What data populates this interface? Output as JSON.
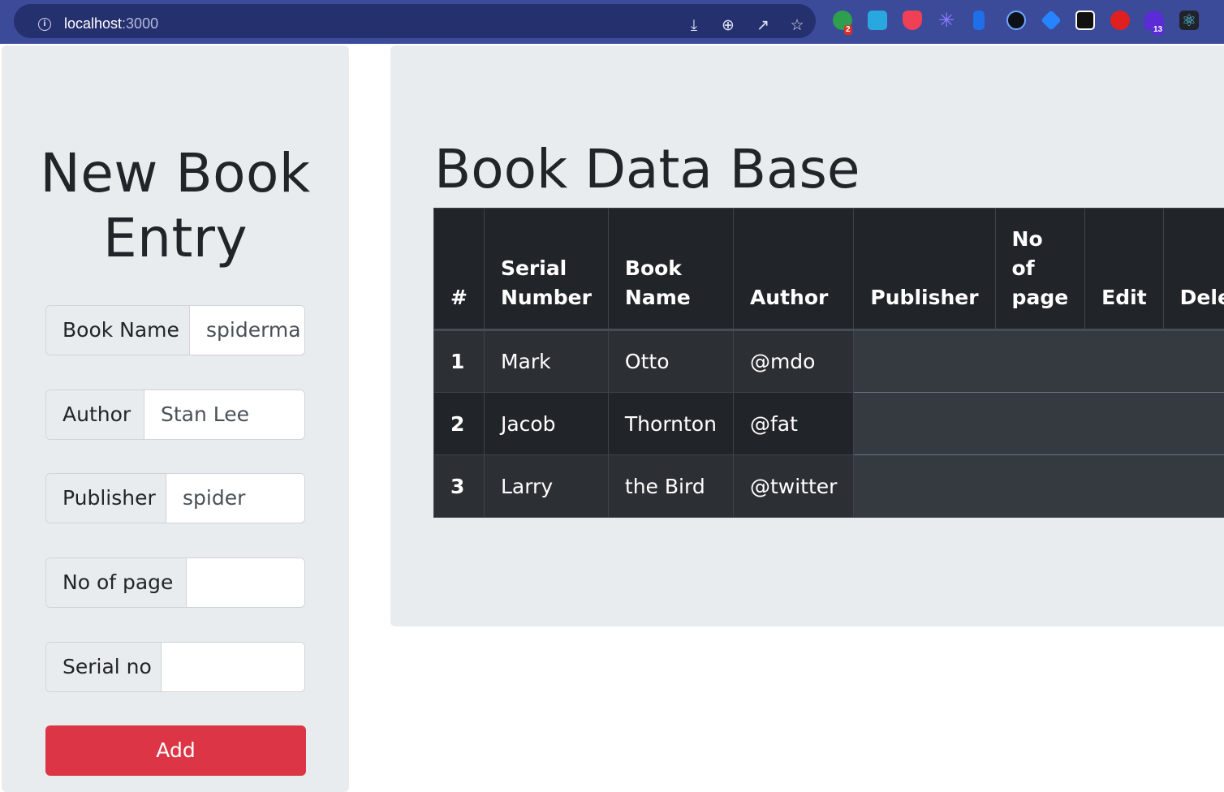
{
  "browser": {
    "url_host": "localhost",
    "url_port": ":3000",
    "extension_badges": [
      "2",
      "13"
    ]
  },
  "entry_form": {
    "title_line1": "New Book",
    "title_line2": "Entry",
    "fields": [
      {
        "label": "Book Name",
        "value": "spiderma"
      },
      {
        "label": "Author",
        "value": "Stan Lee"
      },
      {
        "label": "Publisher",
        "value": "spider"
      },
      {
        "label": "No of page",
        "value": ""
      },
      {
        "label": "Serial no",
        "value": ""
      }
    ],
    "add_label": "Add"
  },
  "database": {
    "title": "Book Data Base",
    "columns": {
      "num": "#",
      "serial_1": "Serial",
      "serial_2": "Number",
      "book_1": "Book",
      "book_2": "Name",
      "author": "Author",
      "publisher": "Publisher",
      "pages_1": "No",
      "pages_2": "of",
      "pages_3": "page",
      "edit": "Edit",
      "delete": "Delete"
    },
    "rows": [
      {
        "num": "1",
        "serial": "Mark",
        "book": "Otto",
        "author": "@mdo"
      },
      {
        "num": "2",
        "serial": "Jacob",
        "book": "Thornton",
        "author": "@fat"
      },
      {
        "num": "3",
        "serial": "Larry",
        "book": "the Bird",
        "author": "@twitter"
      }
    ]
  },
  "colors": {
    "chrome": "#3c4a9a",
    "panel": "#e9ecef",
    "table_dark": "#212529",
    "add_button": "#dc3545"
  }
}
